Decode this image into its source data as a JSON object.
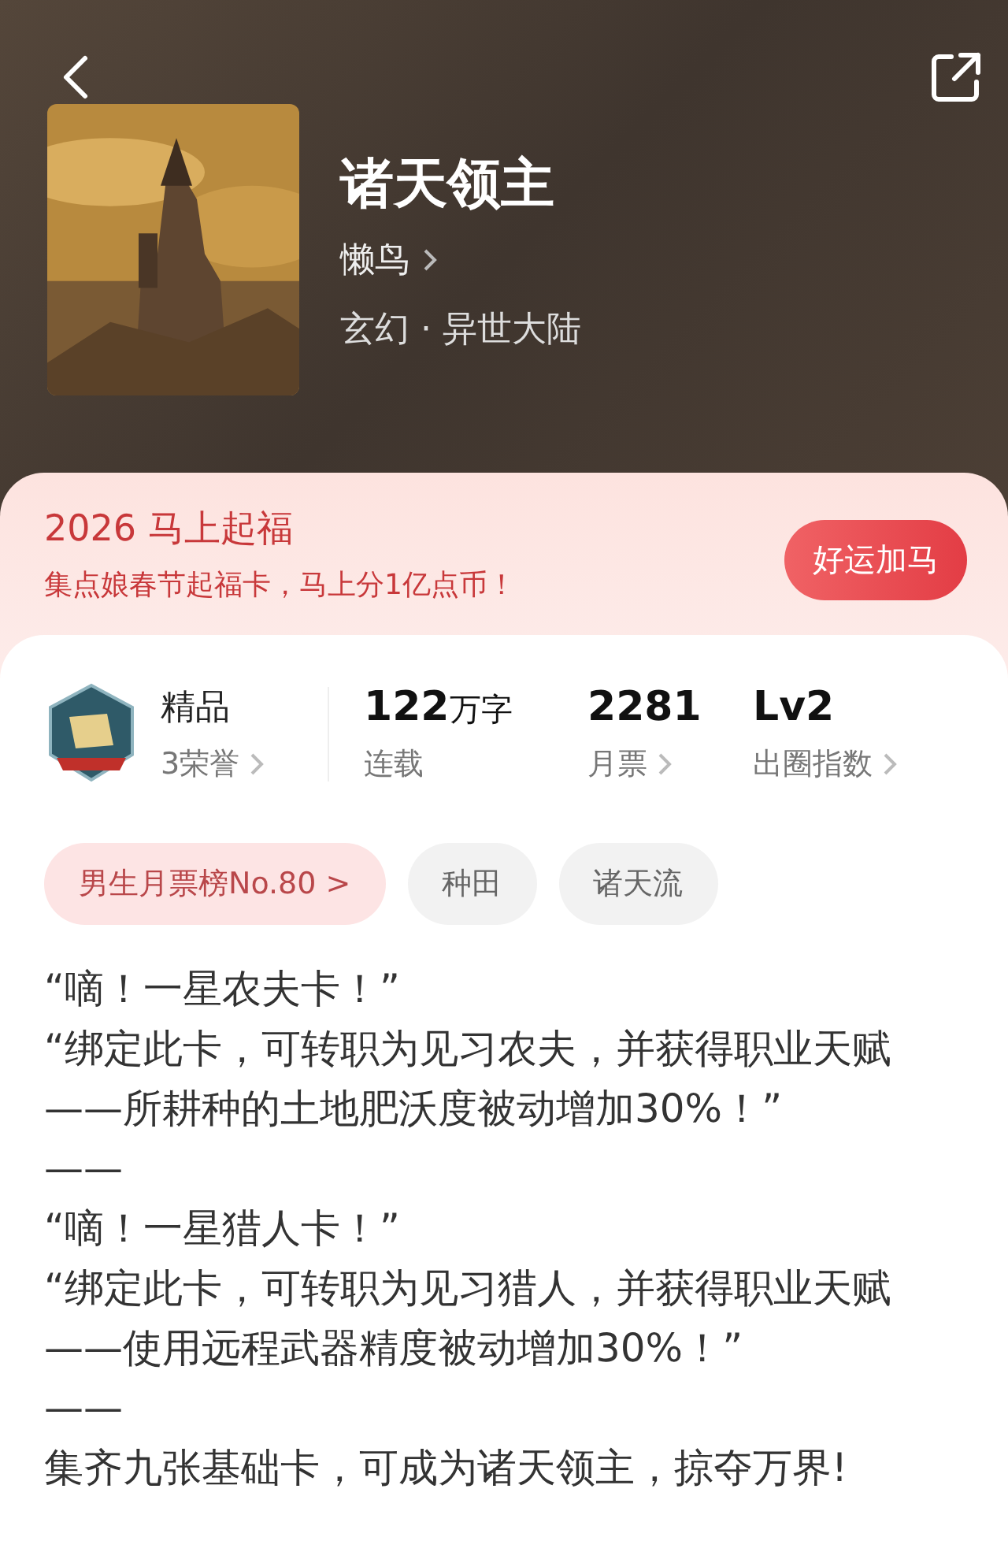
{
  "book": {
    "title": "诸天领主",
    "author": "懒鸟",
    "genre": "玄幻 · 异世大陆"
  },
  "promo": {
    "title": "2026 马上起福",
    "subtitle": "集点娘春节起福卡，马上分1亿点币！",
    "button": "好运加马"
  },
  "honor": {
    "grade": "精品",
    "count": "3荣誉"
  },
  "stats": [
    {
      "value": "122",
      "unit": "万字",
      "label": "连载",
      "link": false
    },
    {
      "value": "2281",
      "label": "月票",
      "link": true
    },
    {
      "value": "Lv2",
      "label": "出圈指数",
      "link": true
    }
  ],
  "tags": [
    {
      "label": "男生月票榜No.80 >",
      "highlighted": true
    },
    {
      "label": "种田",
      "highlighted": false
    },
    {
      "label": "诸天流",
      "highlighted": false
    }
  ],
  "synopsis": [
    "“嘀！一星农夫卡！”",
    "“绑定此卡，可转职为见习农夫，并获得职业天赋——所耕种的土地肥沃度被动增加30%！”",
    "——",
    "“嘀！一星猎人卡！”",
    "“绑定此卡，可转职为见习猎人，并获得职业天赋——使用远程武器精度被动增加30%！”",
    "——",
    "集齐九张基础卡，可成为诸天领主，掠夺万界!"
  ]
}
